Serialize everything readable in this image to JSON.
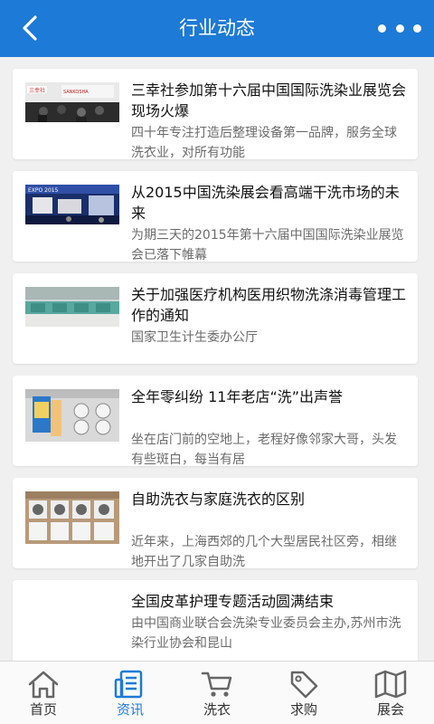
{
  "header": {
    "title": "行业动态",
    "back_icon": "chevron-left-icon",
    "more_icon": "more-dots-icon"
  },
  "colors": {
    "primary": "#1d7ad6",
    "background": "#f0f0f0"
  },
  "articles": [
    {
      "title": "三幸社参加第十六届中国国际洗染业展览会现场火爆",
      "desc": "四十年专注打造后整理设备第一品牌，服务全球洗衣业，对所有功能",
      "thumb": "expo-booth"
    },
    {
      "title": "从2015中国洗染展会看高端干洗市场的未来",
      "desc": "为期三天的2015年第十六届中国国际洗染业展览会已落下帷幕",
      "thumb": "exhibition-hall"
    },
    {
      "title": "关于加强医疗机构医用织物洗涤消毒管理工作的通知",
      "desc": "国家卫生计生委办公厅",
      "thumb": "laundry-machines"
    },
    {
      "title": "全年零纠纷 11年老店“洗”出声誉",
      "desc": "坐在店门前的空地上，老程好像邻家大哥，头发有些斑白，每当有居",
      "thumb": "laundromat"
    },
    {
      "title": "自助洗衣与家庭洗衣的区别",
      "desc": "近年来，上海西郊的几个大型居民社区旁，相继地开出了几家自助洗",
      "thumb": "washers-row"
    },
    {
      "title": "全国皮革护理专题活动圆满结束",
      "desc": "由中国商业联合会洗染专业委员会主办,苏州市洗染行业协会和昆山",
      "thumb": ""
    }
  ],
  "tabs": [
    {
      "label": "首页",
      "icon": "home-icon",
      "active": false
    },
    {
      "label": "资讯",
      "icon": "news-icon",
      "active": true
    },
    {
      "label": "洗衣",
      "icon": "cart-icon",
      "active": false
    },
    {
      "label": "求购",
      "icon": "tag-icon",
      "active": false
    },
    {
      "label": "展会",
      "icon": "map-icon",
      "active": false
    }
  ]
}
